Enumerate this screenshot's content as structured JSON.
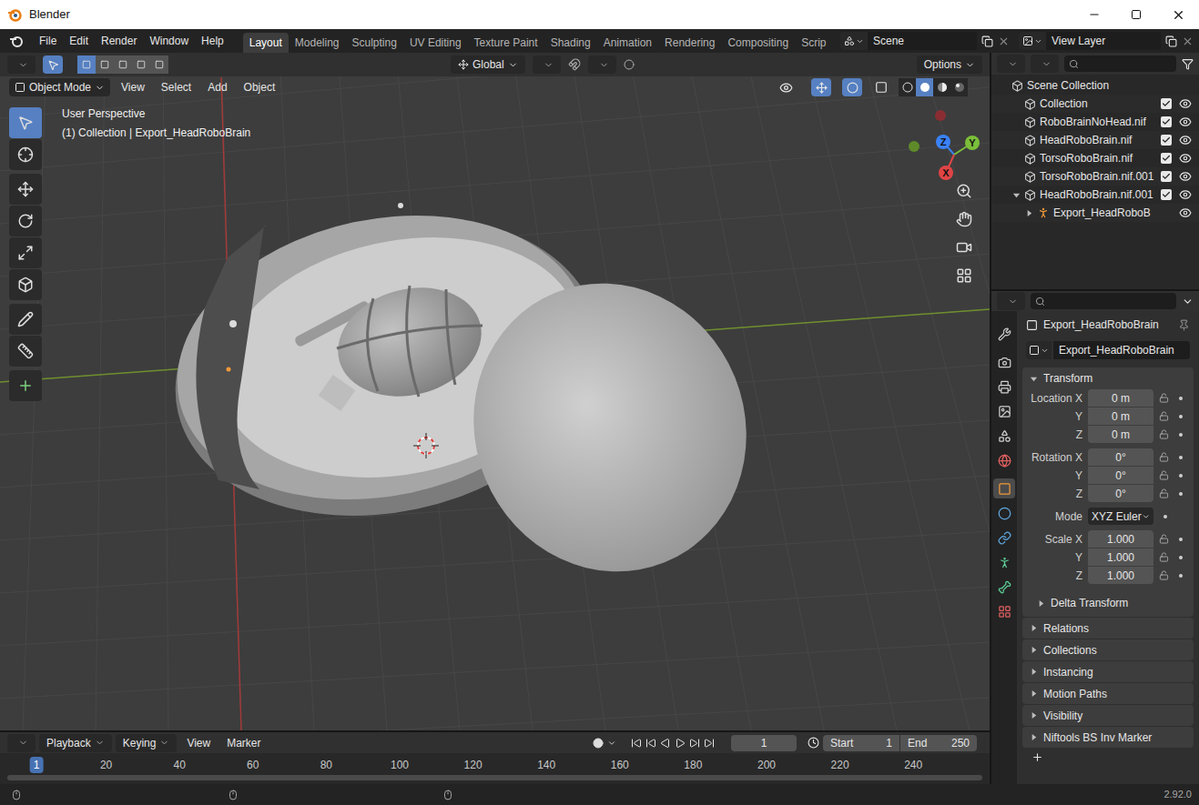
{
  "window": {
    "title": "Blender"
  },
  "menu": [
    "File",
    "Edit",
    "Render",
    "Window",
    "Help"
  ],
  "workspaces": [
    {
      "label": "Layout",
      "selected": true
    },
    {
      "label": "Modeling",
      "selected": false
    },
    {
      "label": "Sculpting",
      "selected": false
    },
    {
      "label": "UV Editing",
      "selected": false
    },
    {
      "label": "Texture Paint",
      "selected": false
    },
    {
      "label": "Shading",
      "selected": false
    },
    {
      "label": "Animation",
      "selected": false
    },
    {
      "label": "Rendering",
      "selected": false
    },
    {
      "label": "Compositing",
      "selected": false
    },
    {
      "label": "Scrip",
      "selected": false
    }
  ],
  "scene": "Scene",
  "view_layer": "View Layer",
  "viewport": {
    "orientation": "Global",
    "options": "Options",
    "mode": "Object Mode",
    "menus": [
      "View",
      "Select",
      "Add",
      "Object"
    ],
    "info": [
      "User Perspective",
      "(1) Collection | Export_HeadRoboBrain"
    ],
    "gizmo": {
      "x": "X",
      "y": "Y",
      "z": "Z"
    },
    "shading": [
      {
        "kind": "wireframe",
        "selected": false
      },
      {
        "kind": "solid",
        "selected": true
      },
      {
        "kind": "material",
        "selected": false
      },
      {
        "kind": "rendered",
        "selected": false
      }
    ],
    "tools": [
      {
        "kind": "select",
        "selected": true
      },
      {
        "kind": "cursor",
        "selected": false
      },
      {
        "kind": "move",
        "selected": false
      },
      {
        "kind": "rotate",
        "selected": false
      },
      {
        "kind": "scale",
        "selected": false
      },
      {
        "kind": "transform",
        "selected": false
      },
      {
        "kind": "annotate",
        "selected": false
      },
      {
        "kind": "measure",
        "selected": false
      },
      {
        "kind": "add",
        "selected": false
      }
    ]
  },
  "outliner": {
    "items": [
      {
        "label": "Scene Collection",
        "depth": 0,
        "kind": "scene"
      },
      {
        "label": "Collection",
        "depth": 1,
        "kind": "collection",
        "checked": true,
        "visible": true
      },
      {
        "label": "RoboBrainNoHead.nif",
        "depth": 1,
        "kind": "collection",
        "checked": true,
        "visible": true
      },
      {
        "label": "HeadRoboBrain.nif",
        "depth": 1,
        "kind": "collection",
        "checked": true,
        "visible": true
      },
      {
        "label": "TorsoRoboBrain.nif",
        "depth": 1,
        "kind": "collection",
        "checked": true,
        "visible": true
      },
      {
        "label": "TorsoRoboBrain.nif.001",
        "depth": 1,
        "kind": "collection",
        "checked": true,
        "visible": true
      },
      {
        "label": "HeadRoboBrain.nif.001",
        "depth": 1,
        "kind": "collection",
        "checked": true,
        "visible": true,
        "expanded": true
      },
      {
        "label": "Export_HeadRoboB",
        "depth": 2,
        "kind": "armature",
        "visible": true,
        "expanded": false
      }
    ]
  },
  "properties": {
    "tabs": [
      {
        "kind": "tool",
        "selected": false
      },
      {
        "kind": "render",
        "selected": false
      },
      {
        "kind": "output",
        "selected": false
      },
      {
        "kind": "view-layer",
        "selected": false
      },
      {
        "kind": "scene",
        "selected": false
      },
      {
        "kind": "world",
        "selected": false
      },
      {
        "kind": "object",
        "selected": true
      },
      {
        "kind": "physics",
        "selected": false
      },
      {
        "kind": "constraints",
        "selected": false
      },
      {
        "kind": "data",
        "selected": false
      },
      {
        "kind": "bone",
        "selected": false
      },
      {
        "kind": "texture",
        "selected": false
      }
    ],
    "object": "Export_HeadRoboBrain",
    "name_field": "Export_HeadRoboBrain",
    "transform": {
      "label": "Transform",
      "expanded": true,
      "groups": [
        [
          {
            "label": "Location X",
            "value": "0 m"
          },
          {
            "label": "Y",
            "value": "0 m"
          },
          {
            "label": "Z",
            "value": "0 m"
          }
        ],
        [
          {
            "label": "Rotation X",
            "value": "0°"
          },
          {
            "label": "Y",
            "value": "0°"
          },
          {
            "label": "Z",
            "value": "0°"
          }
        ],
        [
          {
            "label": "Mode",
            "value": "XYZ Euler"
          }
        ],
        [
          {
            "label": "Scale X",
            "value": "1.000"
          },
          {
            "label": "Y",
            "value": "1.000"
          },
          {
            "label": "Z",
            "value": "1.000"
          }
        ]
      ],
      "subpanel": {
        "label": "Delta Transform",
        "expanded": false
      }
    },
    "panels": [
      {
        "label": "Relations",
        "expanded": false
      },
      {
        "label": "Collections",
        "expanded": false
      },
      {
        "label": "Instancing",
        "expanded": false
      },
      {
        "label": "Motion Paths",
        "expanded": false
      },
      {
        "label": "Visibility",
        "expanded": false
      },
      {
        "label": "Niftools BS Inv Marker",
        "expanded": false
      }
    ]
  },
  "timeline": {
    "menus": [
      "Playback",
      "Keying",
      "View",
      "Marker"
    ],
    "current": "1",
    "start_label": "Start",
    "start": "1",
    "end_label": "End",
    "end": "250",
    "ticks": [
      "1",
      "20",
      "40",
      "60",
      "80",
      "100",
      "120",
      "140",
      "160",
      "180",
      "200",
      "220",
      "240"
    ]
  },
  "status_bar": {
    "version": "2.92.0"
  }
}
